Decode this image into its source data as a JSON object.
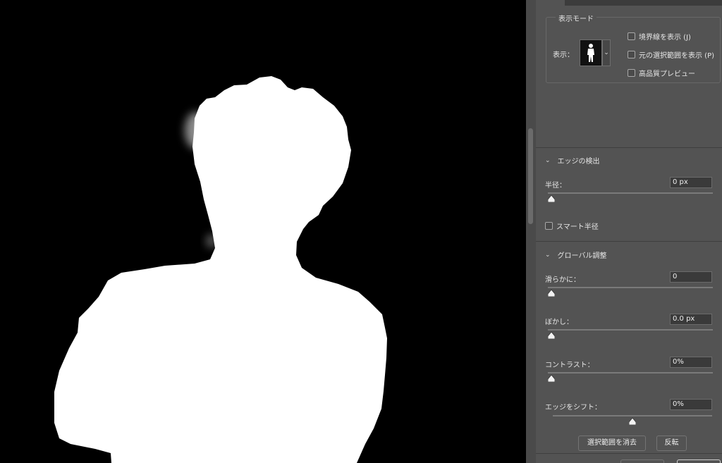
{
  "view_mode": {
    "legend": "表示モード",
    "view_label": "表示：",
    "thumbnail_icon": "person-silhouette-icon",
    "dropdown_icon": "chevron-down-icon",
    "options": [
      {
        "label": "境界線を表示 (J)",
        "checked": false
      },
      {
        "label": "元の選択範囲を表示 (P)",
        "checked": false
      },
      {
        "label": "高品質プレビュー",
        "checked": false
      }
    ]
  },
  "edge_detection": {
    "title": "エッジの検出",
    "radius_label": "半径：",
    "radius_value": "0 px",
    "smart_radius_label": "スマート半径",
    "smart_radius_checked": false
  },
  "global_refine": {
    "title": "グローバル調整",
    "smooth_label": "滑らかに：",
    "smooth_value": "0",
    "feather_label": "ぼかし：",
    "feather_value": "0.0 px",
    "contrast_label": "コントラスト：",
    "contrast_value": "0%",
    "shift_edge_label": "エッジをシフト：",
    "shift_edge_value": "0%"
  },
  "buttons": {
    "clear_selection": "選択範囲を消去",
    "invert": "反転"
  },
  "colors": {
    "panel_bg": "#535353",
    "canvas_bg": "#000000",
    "mask_fg": "#ffffff"
  }
}
